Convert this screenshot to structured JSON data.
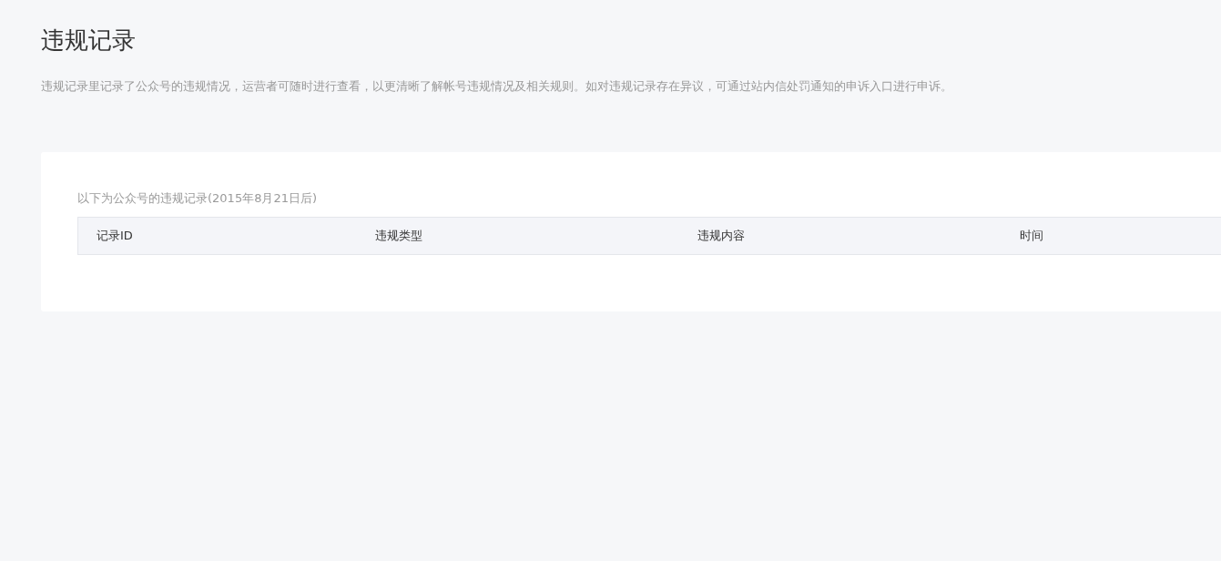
{
  "page": {
    "title": "违规记录",
    "description": "违规记录里记录了公众号的违规情况，运营者可随时进行查看，以更清晰了解帐号违规情况及相关规则。如对违规记录存在异议，可通过站内信处罚通知的申诉入口进行申诉。"
  },
  "records": {
    "caption": "以下为公众号的违规记录(2015年8月21日后)",
    "columns": [
      "记录ID",
      "违规类型",
      "违规内容",
      "时间"
    ]
  }
}
